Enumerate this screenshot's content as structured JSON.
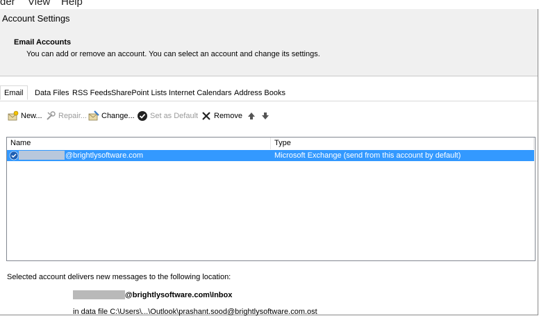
{
  "menubar": {
    "items": [
      "der",
      "View",
      "Help"
    ]
  },
  "window": {
    "title": "Account Settings"
  },
  "header": {
    "title": "Email Accounts",
    "description": "You can add or remove an account. You can select an account and change its settings."
  },
  "tabs": [
    {
      "label": "Email",
      "active": true
    },
    {
      "label": "Data Files"
    },
    {
      "label": "RSS Feeds"
    },
    {
      "label": "SharePoint Lists"
    },
    {
      "label": "Internet Calendars"
    },
    {
      "label": "Address Books"
    }
  ],
  "toolbar": {
    "new": "New...",
    "repair": "Repair...",
    "change": "Change...",
    "set_default": "Set as Default",
    "remove": "Remove"
  },
  "accounts": {
    "columns": [
      "Name",
      "Type"
    ],
    "rows": [
      {
        "name": "@brightlysoftware.com",
        "type": "Microsoft Exchange (send from this account by default)"
      }
    ]
  },
  "delivery": {
    "label": "Selected account delivers new messages to the following location:",
    "location": "@brightlysoftware.com\\Inbox",
    "data_file": "in data file C:\\Users\\...\\Outlook\\prashant.sood@brightlysoftware.com.ost"
  },
  "colors": {
    "selection": "#3399ff",
    "check": "#1e5fb3"
  }
}
